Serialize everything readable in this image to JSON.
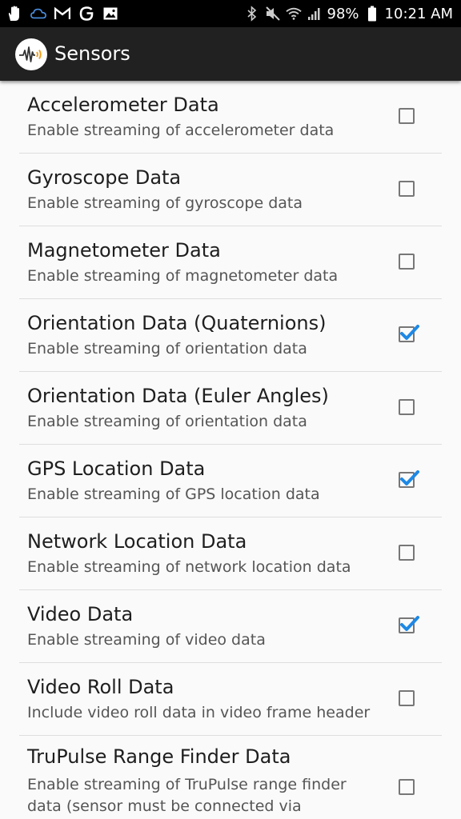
{
  "status_bar": {
    "left_icons": [
      "hand-icon",
      "cloud-icon",
      "gmail-icon",
      "google-icon",
      "image-icon"
    ],
    "right_icons": [
      "bluetooth-icon",
      "mute-icon",
      "wifi-icon",
      "signal-icon",
      "battery-icon"
    ],
    "battery": "98%",
    "time": "10:21 AM"
  },
  "app_bar": {
    "title": "Sensors",
    "logo_icon": "sensor-waveform-icon"
  },
  "accent_color": "#1e88e5",
  "items": [
    {
      "title": "Accelerometer Data",
      "summary": "Enable streaming of accelerometer data",
      "checked": false
    },
    {
      "title": "Gyroscope Data",
      "summary": "Enable streaming of gyroscope data",
      "checked": false
    },
    {
      "title": "Magnetometer Data",
      "summary": "Enable streaming of magnetometer data",
      "checked": false
    },
    {
      "title": "Orientation Data (Quaternions)",
      "summary": "Enable streaming of orientation data",
      "checked": true
    },
    {
      "title": "Orientation Data (Euler Angles)",
      "summary": "Enable streaming of orientation data",
      "checked": false
    },
    {
      "title": "GPS Location Data",
      "summary": "Enable streaming of GPS location data",
      "checked": true
    },
    {
      "title": "Network Location Data",
      "summary": "Enable streaming of network location data",
      "checked": false
    },
    {
      "title": "Video Data",
      "summary": "Enable streaming of video data",
      "checked": true
    },
    {
      "title": "Video Roll Data",
      "summary": "Include video roll data in video frame header",
      "checked": false
    },
    {
      "title": "TruPulse Range Finder Data",
      "summary": "Enable streaming of TruPulse range finder data (sensor must be connected via",
      "checked": false
    }
  ]
}
